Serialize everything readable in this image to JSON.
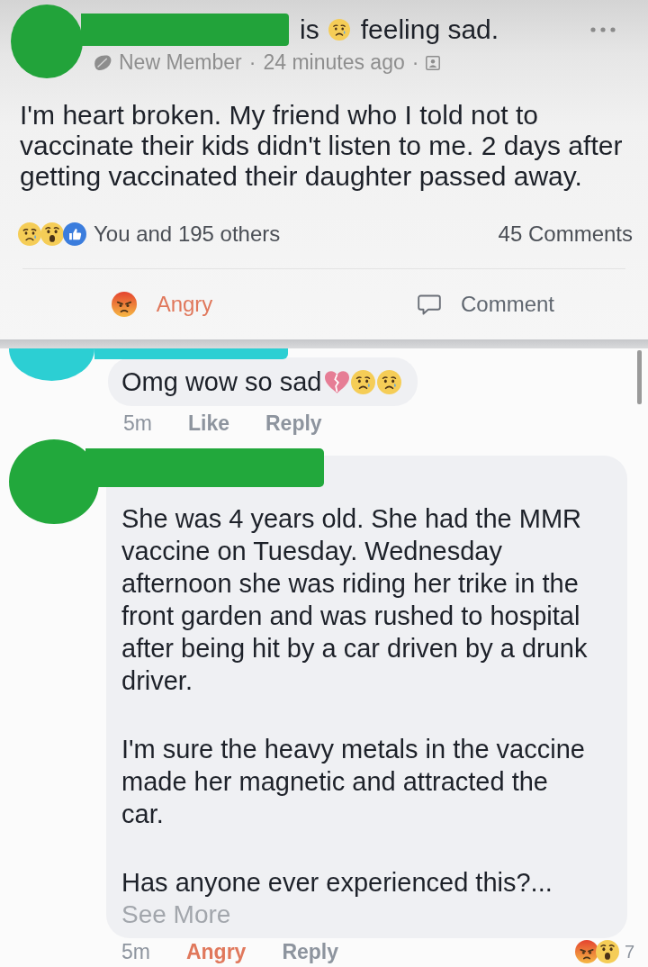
{
  "post": {
    "author": {
      "color": "#22a33a"
    },
    "verb": "is",
    "feeling_icon": {
      "kind": "sad"
    },
    "feeling": "feeling sad.",
    "meta": {
      "badge": "New Member",
      "dot_1": "·",
      "time": "24 minutes ago",
      "dot_2": "·"
    },
    "body": "I'm heart broken. My friend who I told not to vaccinate their kids didn't listen to me. 2 days after getting vaccinated their daughter passed away.",
    "reaction_icons": [
      {
        "kind": "sad"
      },
      {
        "kind": "wow"
      },
      {
        "kind": "like"
      }
    ],
    "reaction_summary": "You and 195 others",
    "comment_count": "45 Comments",
    "actions": [
      {
        "kind": "angry",
        "label": "Angry",
        "selected": true
      },
      {
        "kind": "comment",
        "label": "Comment",
        "selected": false
      }
    ]
  },
  "comments": [
    {
      "author": {
        "color": "#2ccfd3"
      },
      "paragraphs": [
        "Omg wow so sad"
      ],
      "emojis": [
        {
          "kind": "broken_heart"
        },
        {
          "kind": "sad"
        },
        {
          "kind": "sad"
        }
      ],
      "time": "5m",
      "actions": [
        {
          "label": "Like",
          "selected": false
        },
        {
          "label": "Reply",
          "selected": false
        }
      ]
    },
    {
      "author": {
        "color": "#22a83c"
      },
      "paragraphs": [
        "She was 4 years old. She had the MMR vaccine on Tuesday. Wednesday afternoon she was riding her trike in the front garden and was rushed to hospital after being hit by a car driven by a drunk driver.",
        "I'm sure the heavy metals in the vaccine made her magnetic and attracted the car.",
        "Has anyone ever experienced this?..."
      ],
      "see_more": "See More",
      "time": "5m",
      "actions": [
        {
          "label": "Angry",
          "selected": true
        },
        {
          "label": "Reply",
          "selected": false
        }
      ],
      "reactions": [
        {
          "kind": "angry"
        },
        {
          "kind": "wow"
        }
      ],
      "reaction_count": "7"
    }
  ]
}
